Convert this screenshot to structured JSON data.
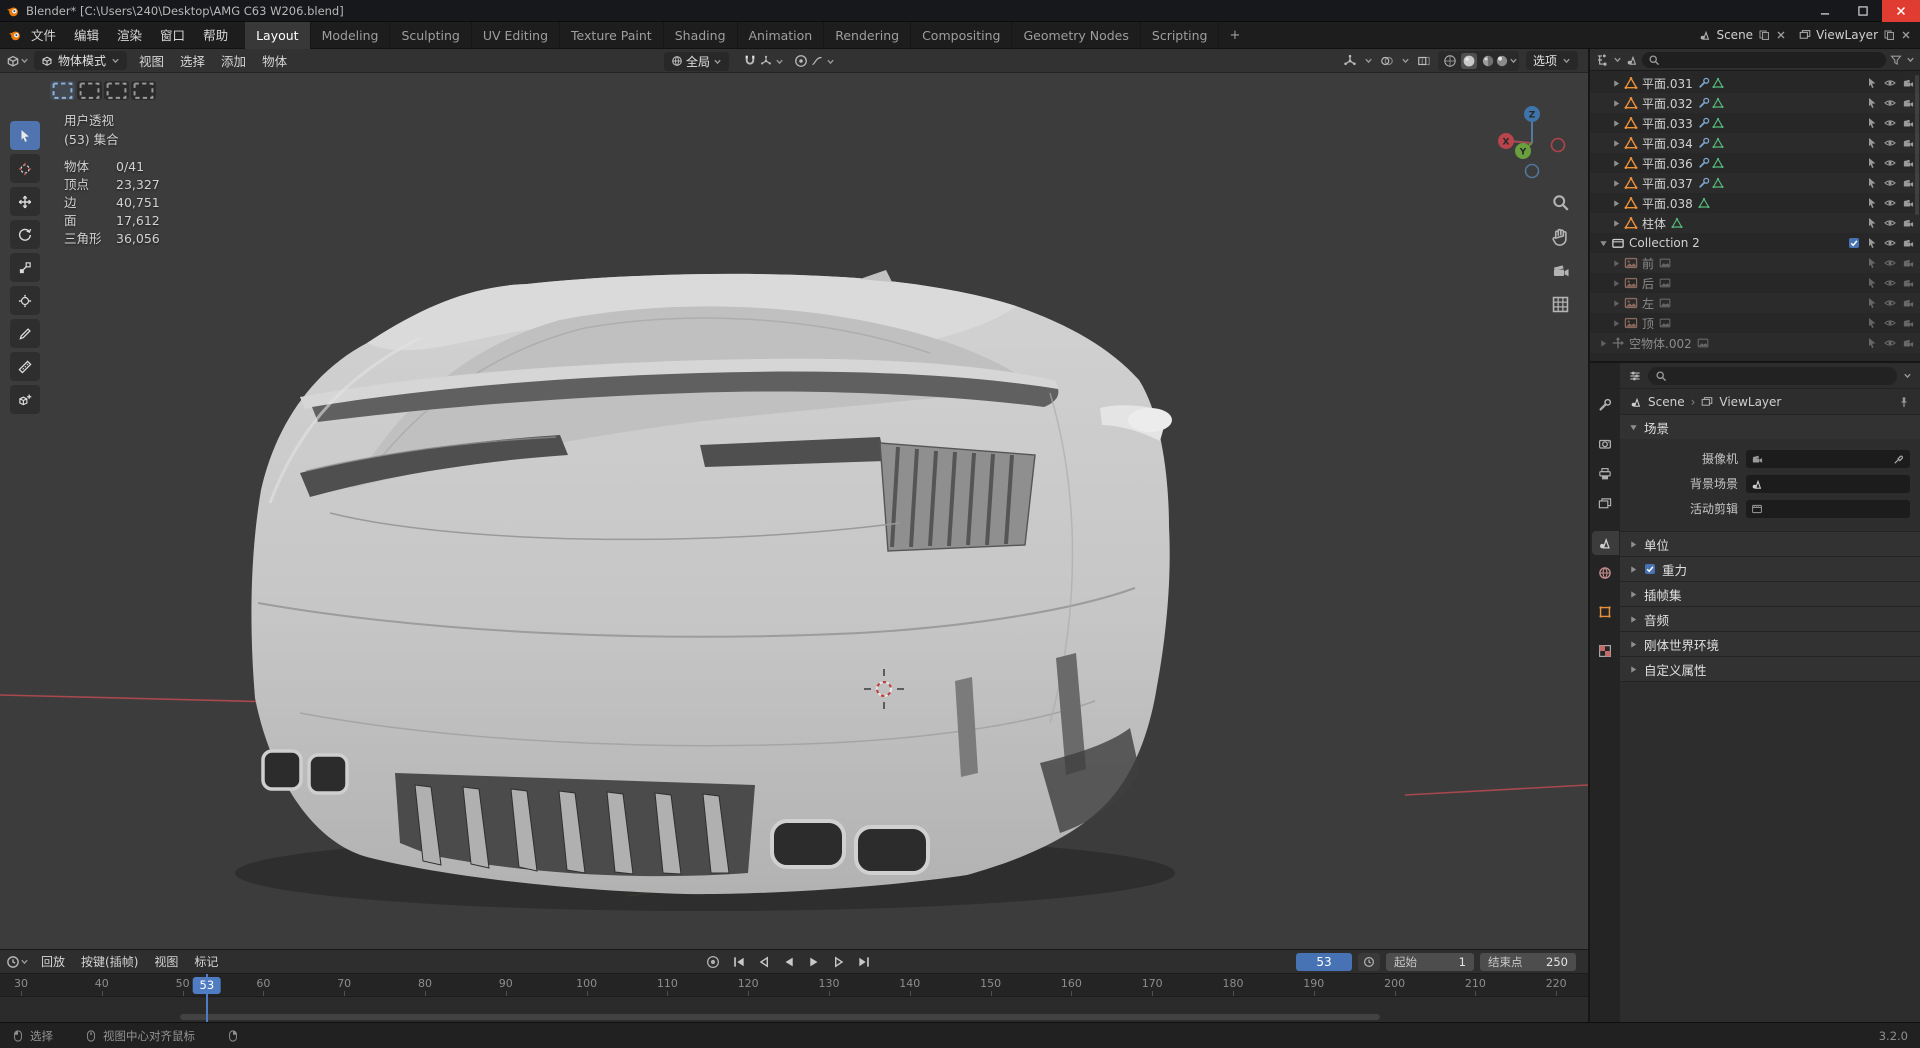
{
  "titlebar": {
    "title": "Blender* [C:\\Users\\240\\Desktop\\AMG C63 W206.blend]"
  },
  "menubar": {
    "menus": [
      "文件",
      "编辑",
      "渲染",
      "窗口",
      "帮助"
    ],
    "workspaces": [
      "Layout",
      "Modeling",
      "Sculpting",
      "UV Editing",
      "Texture Paint",
      "Shading",
      "Animation",
      "Rendering",
      "Compositing",
      "Geometry Nodes",
      "Scripting"
    ],
    "active_workspace": "Layout",
    "new_workspace_label": "+",
    "scene_selector": {
      "label": "Scene"
    },
    "viewlayer_selector": {
      "label": "ViewLayer"
    }
  },
  "tool_header": {
    "mode_label": "物体模式",
    "menus": [
      "视图",
      "选择",
      "添加",
      "物体"
    ],
    "orientation_label": "全局",
    "options_label": "选项"
  },
  "toolbar": {
    "tools": [
      "box-select",
      "cursor",
      "move",
      "rotate",
      "scale",
      "transform",
      "annotate",
      "measure",
      "add-cube"
    ],
    "active_tool": "box-select"
  },
  "viewport": {
    "overlay": {
      "view_name": "用户透视",
      "collection_name": "(53) 集合",
      "stats": [
        {
          "label": "物体",
          "value": "0/41"
        },
        {
          "label": "顶点",
          "value": "23,327"
        },
        {
          "label": "边",
          "value": "40,751"
        },
        {
          "label": "面",
          "value": "17,612"
        },
        {
          "label": "三角形",
          "value": "36,056"
        }
      ]
    },
    "gizmo_axes": {
      "x": "X",
      "y": "Y",
      "z": "Z"
    },
    "colors": {
      "x_axis": "#a8484e",
      "y_axis": "#5f8a2c",
      "accent": "#4772b3"
    }
  },
  "outliner": {
    "search_placeholder": "",
    "rows": [
      {
        "label": "平面.031",
        "type": "mesh",
        "indent": 1,
        "mods": true
      },
      {
        "label": "平面.032",
        "type": "mesh",
        "indent": 1,
        "mods": true
      },
      {
        "label": "平面.033",
        "type": "mesh",
        "indent": 1,
        "mods": true
      },
      {
        "label": "平面.034",
        "type": "mesh",
        "indent": 1,
        "mods": true
      },
      {
        "label": "平面.036",
        "type": "mesh",
        "indent": 1,
        "mods": true
      },
      {
        "label": "平面.037",
        "type": "mesh",
        "indent": 1,
        "mods": true
      },
      {
        "label": "平面.038",
        "type": "mesh",
        "indent": 1,
        "mods": false
      },
      {
        "label": "柱体",
        "type": "mesh",
        "indent": 1,
        "mods": false
      },
      {
        "label": "Collection 2",
        "type": "collection",
        "indent": 0,
        "checkbox": true
      },
      {
        "label": "前",
        "type": "image",
        "indent": 1,
        "muted": true
      },
      {
        "label": "后",
        "type": "image",
        "indent": 1,
        "muted": true
      },
      {
        "label": "左",
        "type": "image",
        "indent": 1,
        "muted": true
      },
      {
        "label": "顶",
        "type": "image",
        "indent": 1,
        "muted": true
      },
      {
        "label": "空物体.002",
        "type": "empty",
        "indent": 0,
        "muted": true
      }
    ]
  },
  "properties": {
    "tabs": [
      "tool",
      "render",
      "output",
      "viewlayer",
      "scene",
      "world",
      "object",
      "texture"
    ],
    "active_tab": "scene",
    "breadcrumb": [
      {
        "label": "Scene"
      },
      {
        "label": "ViewLayer"
      }
    ],
    "panels": [
      {
        "title": "场景",
        "expanded": true,
        "fields": [
          {
            "label": "摄像机"
          },
          {
            "label": "背景场景"
          },
          {
            "label": "活动剪辑"
          }
        ]
      },
      {
        "title": "单位",
        "expanded": false
      },
      {
        "title": "重力",
        "expanded": false,
        "checkbox": true,
        "checked": true
      },
      {
        "title": "插帧集",
        "expanded": false
      },
      {
        "title": "音频",
        "expanded": false
      },
      {
        "title": "刚体世界环境",
        "expanded": false
      },
      {
        "title": "自定义属性",
        "expanded": false
      }
    ]
  },
  "timeline": {
    "menus": [
      "回放",
      "按键(插帧)",
      "视图",
      "标记"
    ],
    "ticks": [
      30,
      40,
      50,
      60,
      70,
      80,
      90,
      100,
      110,
      120,
      130,
      140,
      150,
      160,
      170,
      180,
      190,
      200,
      210,
      220
    ],
    "current_frame": 53,
    "frame_display": "53",
    "start_label": "起始",
    "start_value": "1",
    "end_label": "结束点",
    "end_value": "250"
  },
  "statusbar": {
    "hints": [
      {
        "icon": "mouse-left",
        "label": "选择"
      },
      {
        "icon": "mouse-middle",
        "label": "视图中心对齐鼠标"
      },
      {
        "icon": "mouse-right",
        "label": ""
      }
    ],
    "version": "3.2.0"
  }
}
